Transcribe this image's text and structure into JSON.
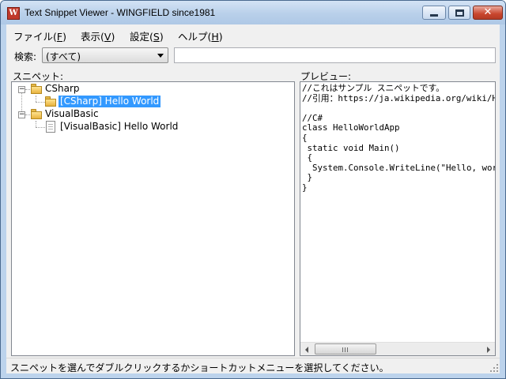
{
  "window": {
    "title": "Text Snippet Viewer - WINGFIELD since1981",
    "icon": "app-logo-icon",
    "icon_letter": "W",
    "close_glyph": "✕"
  },
  "menu": [
    {
      "label": "ファイル(",
      "acc": "F",
      "tail": ")"
    },
    {
      "label": "表示(",
      "acc": "V",
      "tail": ")"
    },
    {
      "label": "設定(",
      "acc": "S",
      "tail": ")"
    },
    {
      "label": "ヘルプ(",
      "acc": "H",
      "tail": ")"
    }
  ],
  "search": {
    "label": "検索:",
    "filter_value": "(すべて)",
    "input_value": ""
  },
  "snippets": {
    "label": "スニペット:",
    "tree": [
      {
        "label": "CSharp",
        "type": "folder",
        "expander": "−"
      },
      {
        "label": "[CSharp] Hello World",
        "type": "folder",
        "selected": true
      },
      {
        "label": "VisualBasic",
        "type": "folder",
        "expander": "−"
      },
      {
        "label": "[VisualBasic] Hello World",
        "type": "document"
      }
    ]
  },
  "preview": {
    "label": "プレビュー:",
    "text": "//これはサンプル スニペットです。\n//引用：https://ja.wikipedia.org/wiki/H\n\n//C#\nclass HelloWorldApp\n{\n static void Main()\n {\n  System.Console.WriteLine(\"Hello, wor\n }\n}"
  },
  "status": {
    "text": "スニペットを選んでダブルクリックするかショートカットメニューを選択してください。"
  },
  "colors": {
    "selection": "#3399ff",
    "title_bar": "#bcd3ec",
    "close_button": "#c9462e"
  }
}
